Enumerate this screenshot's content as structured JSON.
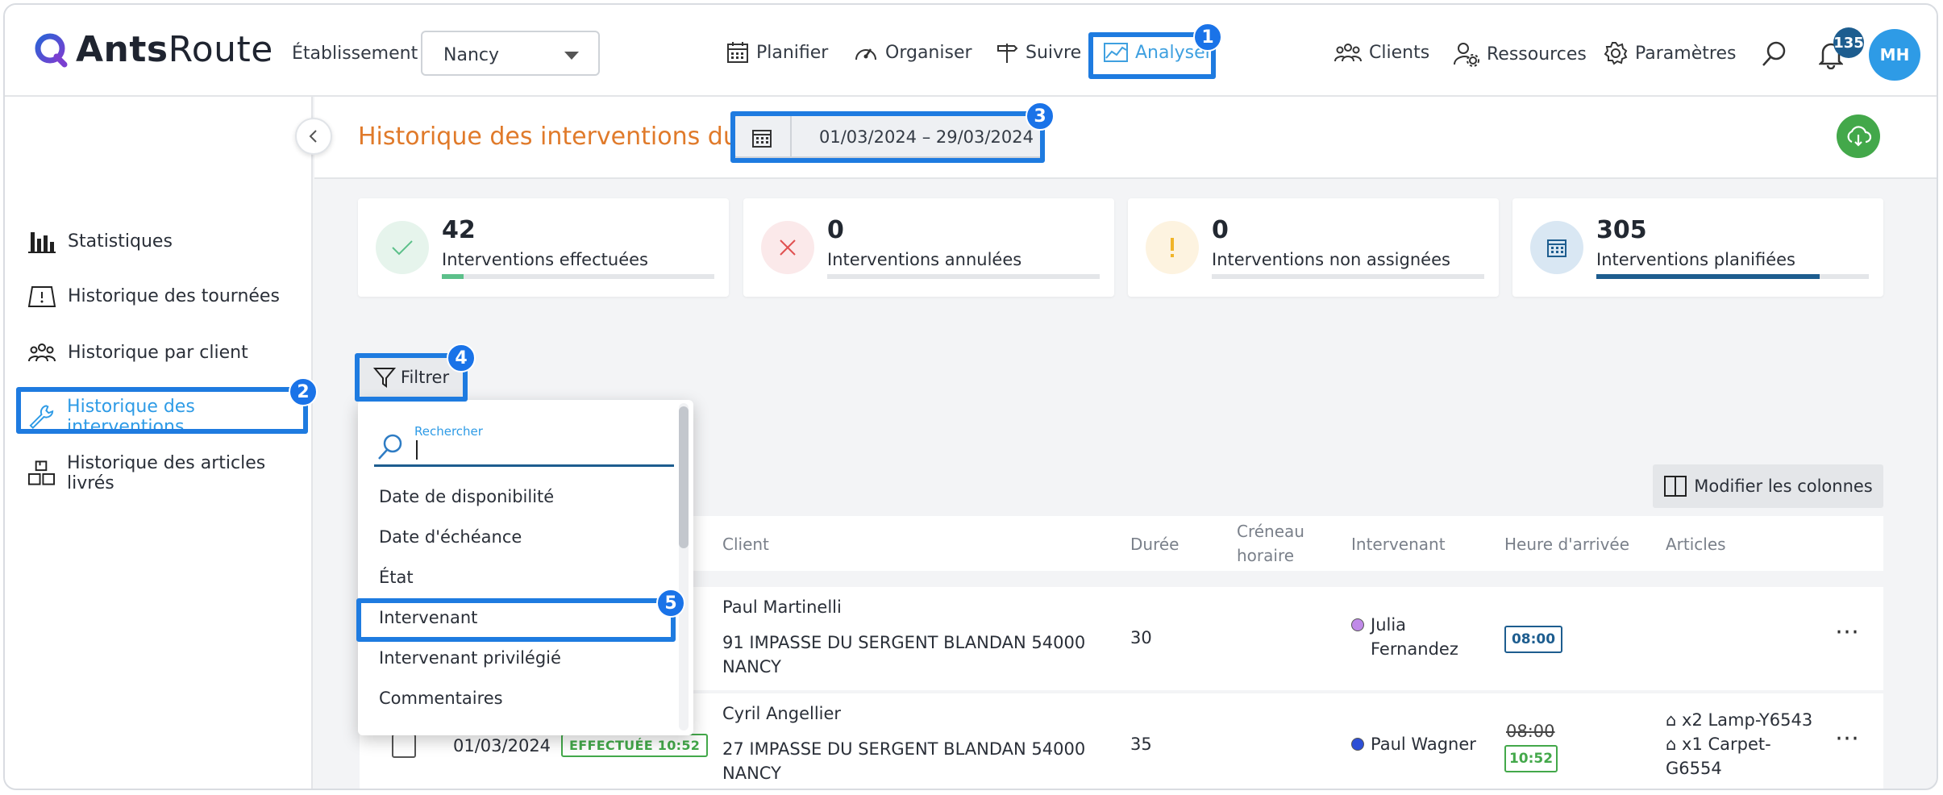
{
  "app": {
    "logo_text_bold": "Ants",
    "logo_text_light": "Route"
  },
  "header": {
    "etablissement_label": "Établissement",
    "etablissement_value": "Nancy",
    "nav": [
      {
        "label": "Planifier",
        "icon": "calendar-icon"
      },
      {
        "label": "Organiser",
        "icon": "gauge-icon"
      },
      {
        "label": "Suivre",
        "icon": "signpost-icon"
      },
      {
        "label": "Analyser",
        "icon": "chart-icon",
        "active": true
      }
    ],
    "right_nav": [
      {
        "label": "Clients",
        "icon": "users-icon"
      },
      {
        "label": "Ressources",
        "icon": "user-gear-icon"
      },
      {
        "label": "Paramètres",
        "icon": "gear-icon"
      }
    ],
    "notification_count": "135",
    "avatar_initials": "MH"
  },
  "sidebar": {
    "items": [
      {
        "label": "Statistiques",
        "icon": "bar-chart-icon"
      },
      {
        "label": "Historique des tournées",
        "icon": "map-icon"
      },
      {
        "label": "Historique par client",
        "icon": "users-icon"
      },
      {
        "label": "Historique des interventions",
        "icon": "wrench-icon",
        "active": true
      },
      {
        "label": "Historique des articles livrés",
        "icon": "boxes-icon"
      }
    ]
  },
  "page": {
    "title": "Historique des interventions du",
    "date_range": "01/03/2024 – 29/03/2024"
  },
  "stats": [
    {
      "value": "42",
      "label": "Interventions effectuées",
      "progress": 0.08,
      "color": "#5cc08a"
    },
    {
      "value": "0",
      "label": "Interventions annulées",
      "progress": 0,
      "color": "#e05050"
    },
    {
      "value": "0",
      "label": "Interventions non assignées",
      "progress": 0,
      "color": "#f0b429"
    },
    {
      "value": "305",
      "label": "Interventions planifiées",
      "progress": 0.82,
      "color": "#1d5d8f"
    }
  ],
  "toolbar": {
    "filter_label": "Filtrer",
    "columns_label": "Modifier les colonnes"
  },
  "filter_dropdown": {
    "search_label": "Rechercher",
    "options": [
      "Date de disponibilité",
      "Date d'échéance",
      "État",
      "Intervenant",
      "Intervenant privilégié",
      "Commentaires"
    ]
  },
  "table": {
    "headers": [
      "Client",
      "Durée",
      "Créneau horaire",
      "Intervenant",
      "Heure d'arrivée",
      "Articles"
    ],
    "header_creneau_line1": "Créneau",
    "header_creneau_line2": "horaire",
    "rows": [
      {
        "client_name": "Paul Martinelli",
        "address_line1": "91 IMPASSE DU SERGENT BLANDAN 54000",
        "address_line2": "NANCY",
        "duration": "30",
        "intervenant_line1": "Julia",
        "intervenant_line2": "Fernandez",
        "intervenant_color": "#c08ae8",
        "arrival": "08:00"
      },
      {
        "date": "01/03/2024",
        "state": "EFFECTUÉE 10:52",
        "client_name": "Cyril Angellier",
        "address_line1": "27 IMPASSE DU SERGENT BLANDAN 54000",
        "address_line2": "NANCY",
        "duration": "35",
        "intervenant": "Paul Wagner",
        "intervenant_color": "#2d4fd6",
        "arrival_planned": "08:00",
        "arrival_actual": "10:52",
        "article_1": "x2 Lamp-Y6543",
        "article_2_line1": "x1 Carpet-",
        "article_2_line2": "G6554"
      }
    ]
  },
  "annotations": [
    "1",
    "2",
    "3",
    "4",
    "5"
  ]
}
